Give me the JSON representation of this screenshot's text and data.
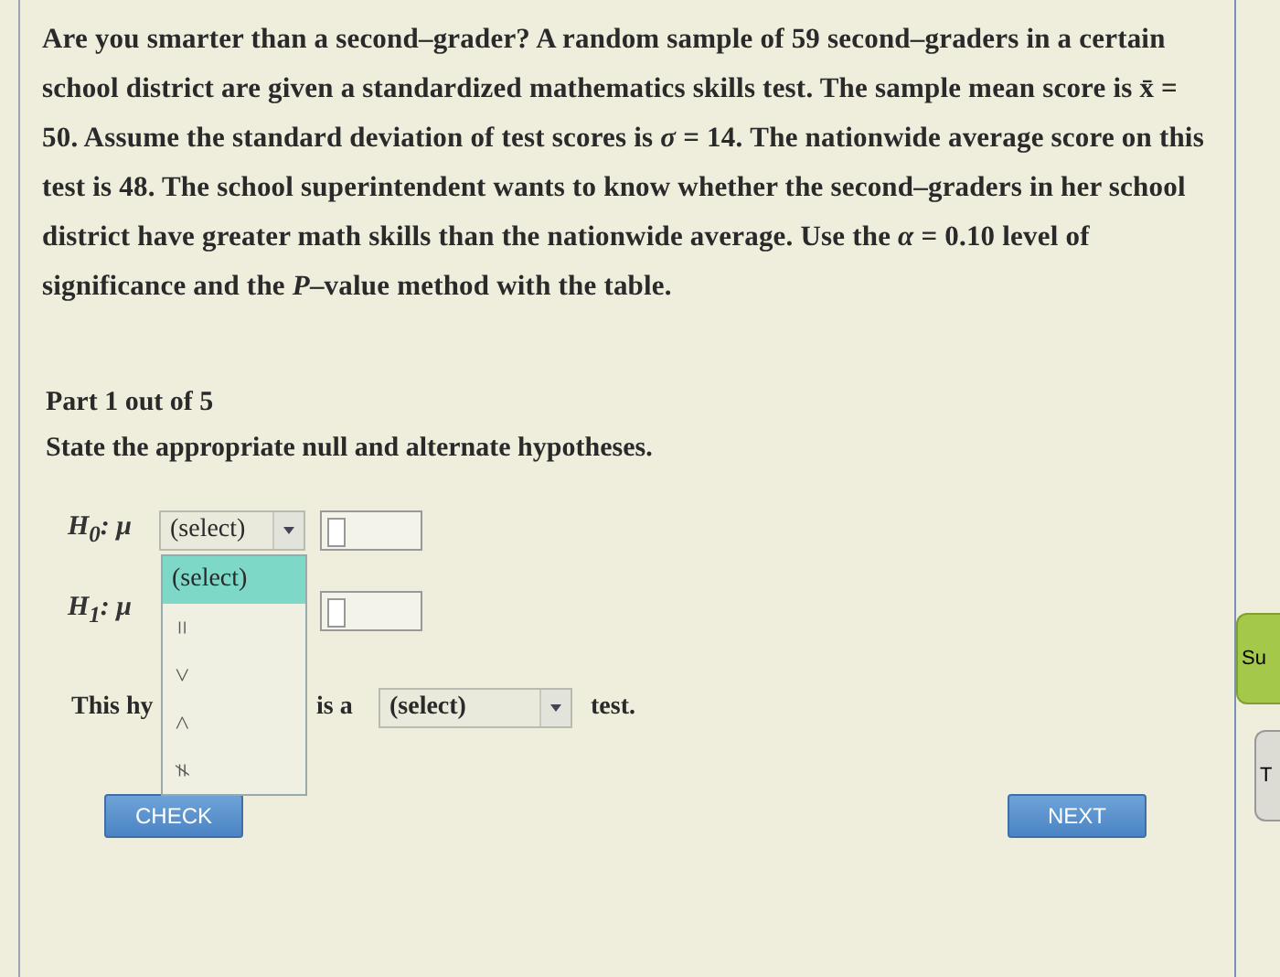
{
  "question": {
    "text": "Are you smarter than a second–grader? A random sample of 59 second–graders in a certain school district are given a standardized mathematics skills test. The sample mean score is x̄ = 50. Assume the standard deviation of test scores is *σ* = 14. The nationwide average score on this test is 48. The school superintendent wants to know whether the second–graders in her school district have greater math skills than the nationwide average. Use the *α* = 0.10 level of significance and the *P*–value method with the table."
  },
  "part": {
    "label": "Part 1 out of 5",
    "instruction": "State the appropriate null and alternate hypotheses."
  },
  "hypotheses": [
    {
      "label": "H$_{0}$: μ",
      "select": "(select)"
    },
    {
      "label": "H$_{1}$: μ"
    }
  ],
  "dropdown": {
    "open": true,
    "options": [
      {
        "label": "(select)",
        "selected": true
      },
      {
        "label": "=",
        "selected": false
      },
      {
        "label": ">",
        "selected": false
      },
      {
        "label": "<",
        "selected": false
      },
      {
        "label": "≠",
        "selected": false
      }
    ]
  },
  "conclusion": {
    "lead": "This hy",
    "connector": "is a",
    "select": "(select)",
    "tail": "test."
  },
  "buttons": {
    "check": "CHECK",
    "next": "NEXT"
  },
  "side_buttons": [
    {
      "label": "Su",
      "kind": "primary"
    },
    {
      "label": "T",
      "kind": "secondary"
    }
  ]
}
